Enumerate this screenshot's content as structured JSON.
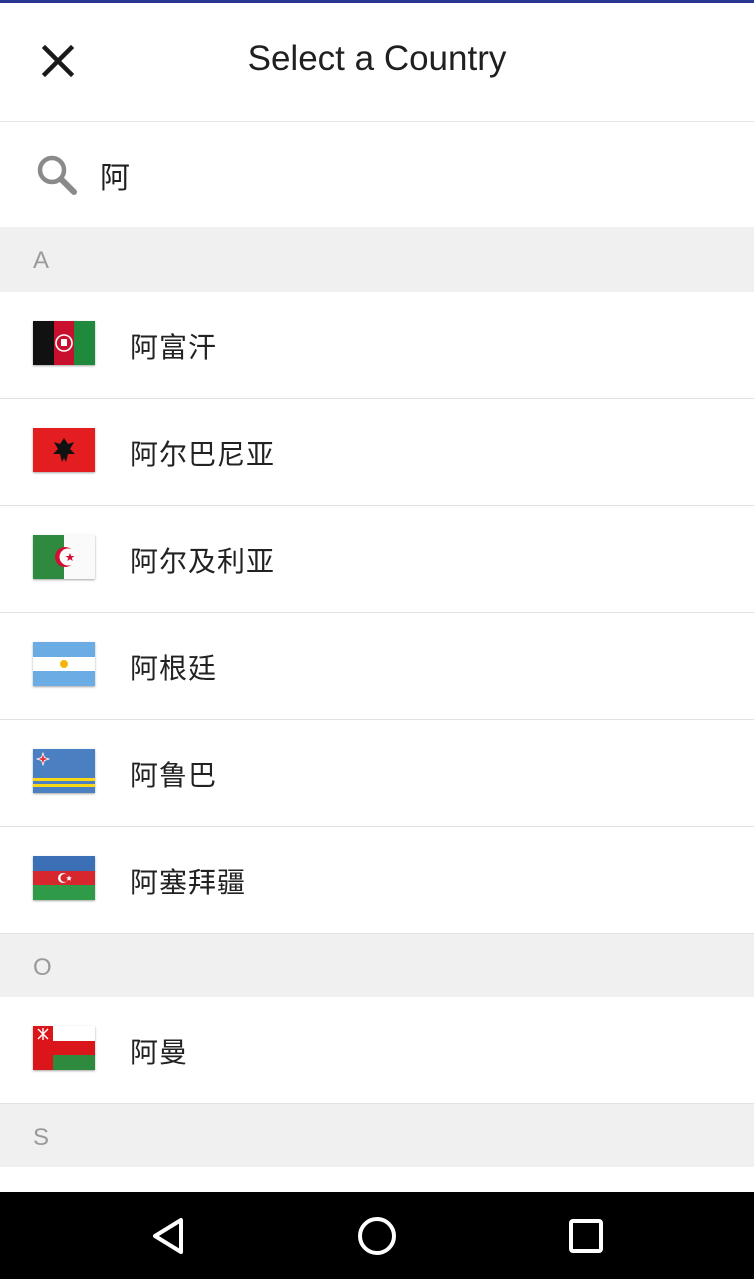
{
  "header": {
    "title": "Select a Country",
    "close_icon": "close-icon"
  },
  "search": {
    "icon": "search-icon",
    "value": "阿"
  },
  "sections": [
    {
      "letter": "A",
      "countries": [
        {
          "name": "阿富汗",
          "flag": "afghanistan-flag-icon"
        },
        {
          "name": "阿尔巴尼亚",
          "flag": "albania-flag-icon"
        },
        {
          "name": "阿尔及利亚",
          "flag": "algeria-flag-icon"
        },
        {
          "name": "阿根廷",
          "flag": "argentina-flag-icon"
        },
        {
          "name": "阿鲁巴",
          "flag": "aruba-flag-icon"
        },
        {
          "name": "阿塞拜疆",
          "flag": "azerbaijan-flag-icon"
        }
      ]
    },
    {
      "letter": "O",
      "countries": [
        {
          "name": "阿曼",
          "flag": "oman-flag-icon"
        }
      ]
    },
    {
      "letter": "S",
      "countries": []
    }
  ],
  "navbar": {
    "back_icon": "back-triangle-icon",
    "home_icon": "home-circle-icon",
    "recents_icon": "recents-square-icon"
  },
  "colors": {
    "accent": "#283593",
    "section_bg": "#f0f0f0",
    "navbar_bg": "#000000"
  }
}
